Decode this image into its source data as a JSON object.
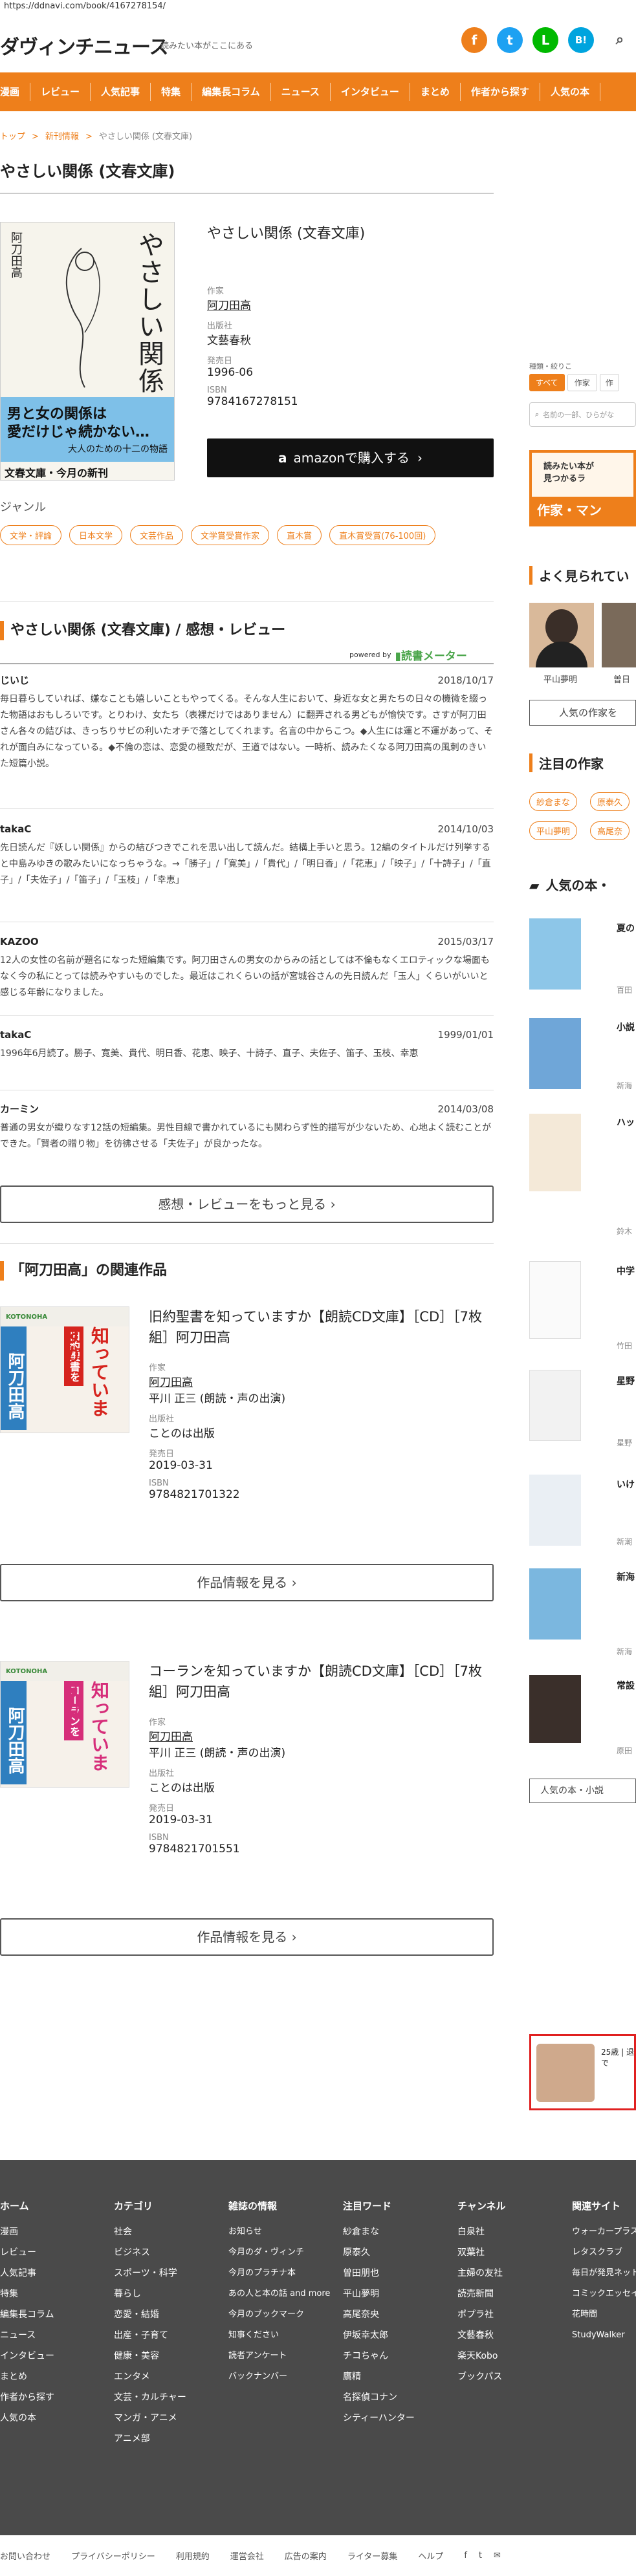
{
  "url": "https://ddnavi.com/book/4167278154/",
  "header": {
    "logo": "ダヴィンチニュース",
    "tagline": "読みたい本がここにある",
    "social": [
      "f",
      "t",
      "L",
      "B!",
      "✉"
    ]
  },
  "nav": [
    "漫画",
    "レビュー",
    "人気記事",
    "特集",
    "編集長コラム",
    "ニュース",
    "インタビュー",
    "まとめ",
    "作者から探す",
    "人気の本"
  ],
  "breadcrumb": [
    "トップ",
    "新刊情報",
    "やさしい関係 (文春文庫)"
  ],
  "page_title": "やさしい関係 (文春文庫)",
  "book": {
    "title": "やさしい関係 (文春文庫)",
    "author_label": "作家",
    "author": "阿刀田高",
    "publisher_label": "出版社",
    "publisher": "文藝春秋",
    "date_label": "発売日",
    "date": "1996-06",
    "isbn_label": "ISBN",
    "isbn": "9784167278151",
    "amazon_button": "amazonで購入する",
    "cover_title": "やさしい関係",
    "cover_author": "阿刀田高",
    "cover_band1": "男と女の関係は",
    "cover_band2": "愛だけじゃ続かない…",
    "cover_band3": "大人のための十二の物語",
    "cover_footer": "文春文庫・今月の新刊"
  },
  "genre": {
    "label": "ジャンル",
    "tags": [
      "文学・評論",
      "日本文学",
      "文芸作品",
      "文学賞受賞作家",
      "直木賞",
      "直木賞受賞(76-100回)"
    ]
  },
  "reviews_section": {
    "title": "やさしい関係 (文春文庫) / 感想・レビュー",
    "powered": "powered by",
    "meter": "読書メーター",
    "more_button": "感想・レビューをもっと見る"
  },
  "reviews": [
    {
      "user": "じいじ",
      "date": "2018/10/17",
      "text": "毎日暮らしていれば、嫌なことも嬉しいこともやってくる。そんな人生において、身近な女と男たちの日々の機微を綴った物語はおもしろいです。とりわけ、女たち（表裸だけではありません）に翻弄される男どもが愉快です。さすが阿刀田さん各々の結びは、きっちりサビの利いたオチで落としてくれます。名言の中からこつ。◆人生には運と不運があって、それが面白みになっている。◆不倫の恋は、恋愛の極致だが、王道ではない。一時析、読みたくなる阿刀田高の風刺のきいた短篇小説。"
    },
    {
      "user": "takaC",
      "date": "2014/10/03",
      "text": "先日読んだ『妖しい関係』からの結びつきでこれを思い出して読んだ。結構上手いと思う。12編のタイトルだけ列挙すると中島みゆきの歌みたいになっちゃうな。→「勝子」/「寛美」/「貴代」/「明日香」/「花恵」/「映子」/「十詩子」/「直子」/「夫佐子」/「笛子」/「玉枝」/「幸恵」"
    },
    {
      "user": "KAZOO",
      "date": "2015/03/17",
      "text": "12人の女性の名前が題名になった短編集です。阿刀田さんの男女のからみの話としては不倫もなくエロティックな場面もなく今の私にとっては読みやすいものでした。最近はこれくらいの話が宮城谷さんの先日読んだ「玉人」くらいがいいと感じる年齢になりました。"
    },
    {
      "user": "takaC",
      "date": "1999/01/01",
      "text": "1996年6月読了。勝子、寛美、貴代、明日香、花恵、映子、十詩子、直子、夫佐子、笛子、玉枝、幸恵"
    },
    {
      "user": "カーミン",
      "date": "2014/03/08",
      "text": "普通の男女が織りなす12話の短編集。男性目線で書かれているにも関わらず性的描写が少ないため、心地よく読むことができた。「賢者の贈り物」を彷彿させる「夫佐子」が良かったな。"
    }
  ],
  "related": {
    "title": "「阿刀田高」の関連作品",
    "more_button": "作品情報を見る",
    "items": [
      {
        "title": "旧約聖書を知っていますか【朗読CD文庫】［CD］［7枚組］阿刀田高",
        "author_label": "作家",
        "author": "阿刀田高",
        "author2": "平川 正三 (朗読・声の出演)",
        "publisher_label": "出版社",
        "publisher": "ことのは出版",
        "date_label": "発売日",
        "date": "2019-03-31",
        "isbn_label": "ISBN",
        "isbn": "9784821701322",
        "cover_band": "旧約聖書を",
        "cover_big": "知っていますか",
        "cover_author": "阿刀田高",
        "cover_brand": "KOTONOHA"
      },
      {
        "title": "コーランを知っていますか【朗読CD文庫】［CD］［7枚組］阿刀田高",
        "author_label": "作家",
        "author": "阿刀田高",
        "author2": "平川 正三 (朗読・声の出演)",
        "publisher_label": "出版社",
        "publisher": "ことのは出版",
        "date_label": "発売日",
        "date": "2019-03-31",
        "isbn_label": "ISBN",
        "isbn": "9784821701551",
        "cover_band": "コーランを",
        "cover_big": "知っていますか",
        "cover_author": "阿刀田高",
        "cover_brand": "KOTONOHA"
      }
    ]
  },
  "sidebar": {
    "search_label": "種類・絞りこ",
    "search_tabs": [
      "すべて",
      "作家",
      "作"
    ],
    "search_placeholder": "名前の一部、ひらがな",
    "banner_top": "読みたい本が",
    "banner_mid": "見つかるラ",
    "banner_bottom": "作家・マン",
    "popular_authors_title": "よく見られてい",
    "authors": [
      "平山夢明",
      "曽日"
    ],
    "authors_button": "人気の作家を",
    "noted_title": "注目の作家",
    "noted_tags": [
      "紗倉まな",
      "原泰久",
      "平山夢明",
      "高尾奈"
    ],
    "popular_books_title": "人気の本・",
    "books": [
      {
        "text": "夏の",
        "sub": "百田"
      },
      {
        "text": "小説",
        "sub": "新海"
      },
      {
        "text": "ハッ",
        "sub": "鈴木"
      },
      {
        "text": "中学",
        "sub": "竹田"
      },
      {
        "text": "星野",
        "sub": "星野"
      },
      {
        "text": "いけ",
        "sub": "新潮"
      },
      {
        "text": "新海",
        "sub": "新海"
      },
      {
        "text": "常設",
        "sub": "原田"
      }
    ],
    "books_button": "人気の本・小説",
    "ad_text": "25歳 | 退で"
  },
  "footer": {
    "columns": [
      {
        "head": "ホーム",
        "items": [
          "漫画",
          "レビュー",
          "人気記事",
          "特集",
          "編集長コラム",
          "ニュース",
          "インタビュー",
          "まとめ",
          "作者から探す",
          "人気の本"
        ]
      },
      {
        "head": "カテゴリ",
        "items": [
          "社会",
          "ビジネス",
          "スポーツ・科学",
          "暮らし",
          "恋愛・結婚",
          "出産・子育て",
          "健康・美容",
          "エンタメ",
          "文芸・カルチャー",
          "マンガ・アニメ",
          "アニメ部"
        ]
      },
      {
        "head": "雑誌の情報",
        "items": [
          "お知らせ",
          "今月のダ・ヴィンチ",
          "今月のプラチナ本",
          "あの人と本の話 and more",
          "今月のブックマーク",
          "知事ください",
          "読者アンケート",
          "バックナンバー"
        ]
      },
      {
        "head": "注目ワード",
        "items": [
          "紗倉まな",
          "原泰久",
          "曽田朋也",
          "平山夢明",
          "高尾奈央",
          "伊坂幸太郎",
          "チコちゃん",
          "鷹精",
          "名探偵コナン",
          "シティーハンター"
        ]
      },
      {
        "head": "チャンネル",
        "items": [
          "白泉社",
          "双葉社",
          "主婦の友社",
          "読売新聞",
          "ポプラ社",
          "文藝春秋",
          "楽天Kobo",
          "ブックパス"
        ]
      },
      {
        "head": "関連サイト",
        "items": [
          "ウォーカープラス",
          "レタスクラブ",
          "毎日が発見ネット",
          "コミックエッセイ",
          "花時間",
          "StudyWalker"
        ]
      }
    ],
    "bottom_links": [
      "お問い合わせ",
      "プライバシーポリシー",
      "利用規約",
      "運営会社",
      "広告の案内",
      "ライター募集",
      "ヘルプ",
      "f",
      "t",
      "✉"
    ]
  },
  "colors": {
    "accent": "#ee7f1b",
    "text": "#333333",
    "footer": "#4a4a4a"
  }
}
